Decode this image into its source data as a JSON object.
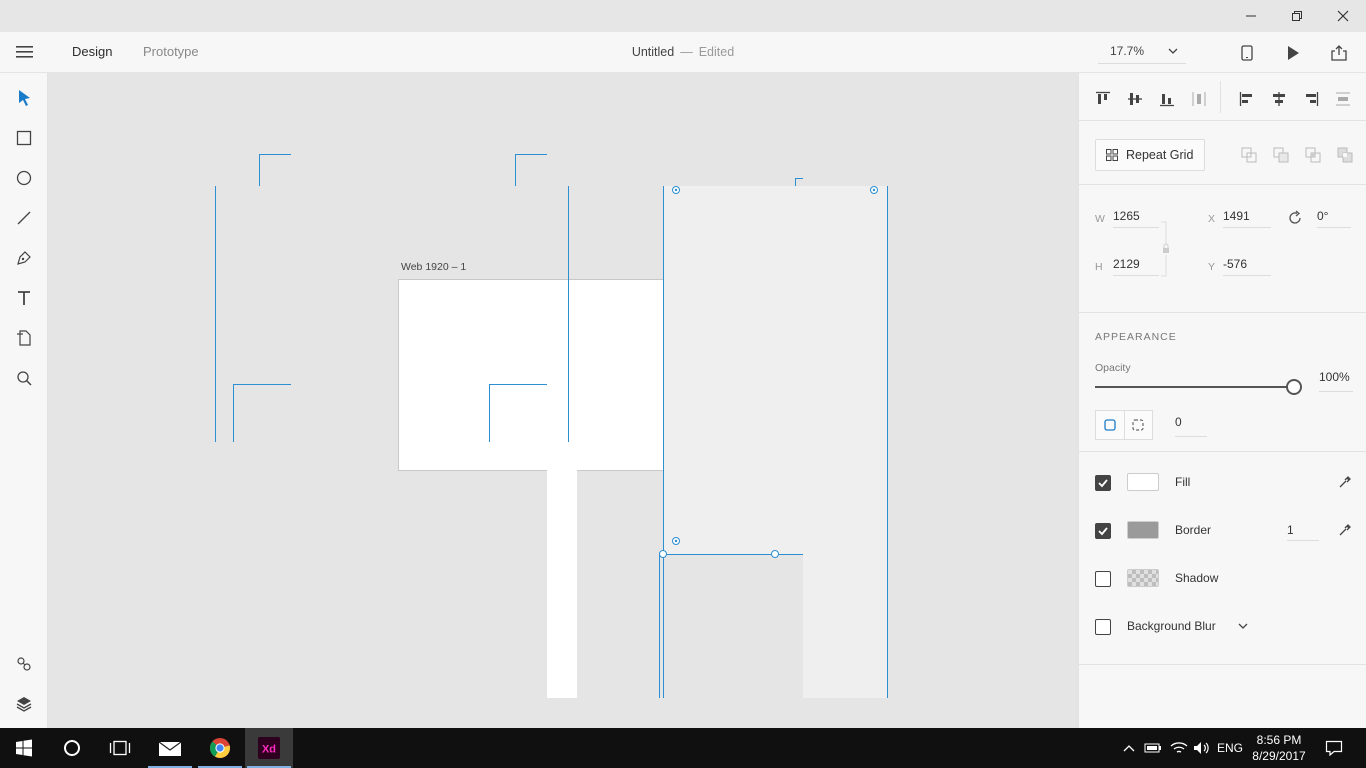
{
  "header": {
    "tabs": [
      {
        "label": "Design",
        "active": true
      },
      {
        "label": "Prototype",
        "active": false
      }
    ],
    "doc_name": "Untitled",
    "separator": "—",
    "doc_status": "Edited",
    "zoom": "17.7%"
  },
  "canvas": {
    "artboard_label": "Web 1920 – 1",
    "selection_color": "#2d8ed1"
  },
  "inspector": {
    "repeat_grid_label": "Repeat Grid",
    "transform": {
      "w_label": "W",
      "w_value": "1265",
      "h_label": "H",
      "h_value": "2129",
      "x_label": "X",
      "x_value": "1491",
      "y_label": "Y",
      "y_value": "-576",
      "rotation_value": "0°"
    },
    "appearance": {
      "title": "APPEARANCE",
      "opacity_label": "Opacity",
      "opacity_value": "100%",
      "opacity_fraction": 1.0,
      "corner_radius": "0",
      "fill": {
        "label": "Fill",
        "checked": true,
        "color": "#ffffff"
      },
      "border": {
        "label": "Border",
        "checked": true,
        "color": "#9a9a9a",
        "width": "1"
      },
      "shadow": {
        "label": "Shadow",
        "checked": false
      },
      "background_blur": {
        "label": "Background Blur",
        "checked": false
      }
    }
  },
  "taskbar": {
    "language": "ENG",
    "time": "8:56 PM",
    "date": "8/29/2017",
    "apps": [
      "start-icon",
      "cortana-icon",
      "task-view-icon",
      "mail-icon",
      "chrome-icon",
      "xd-icon"
    ]
  },
  "colors": {
    "accent": "#2d8ed1",
    "xd_brand": "#ff2bc2",
    "xd_bg": "#2e001f"
  }
}
